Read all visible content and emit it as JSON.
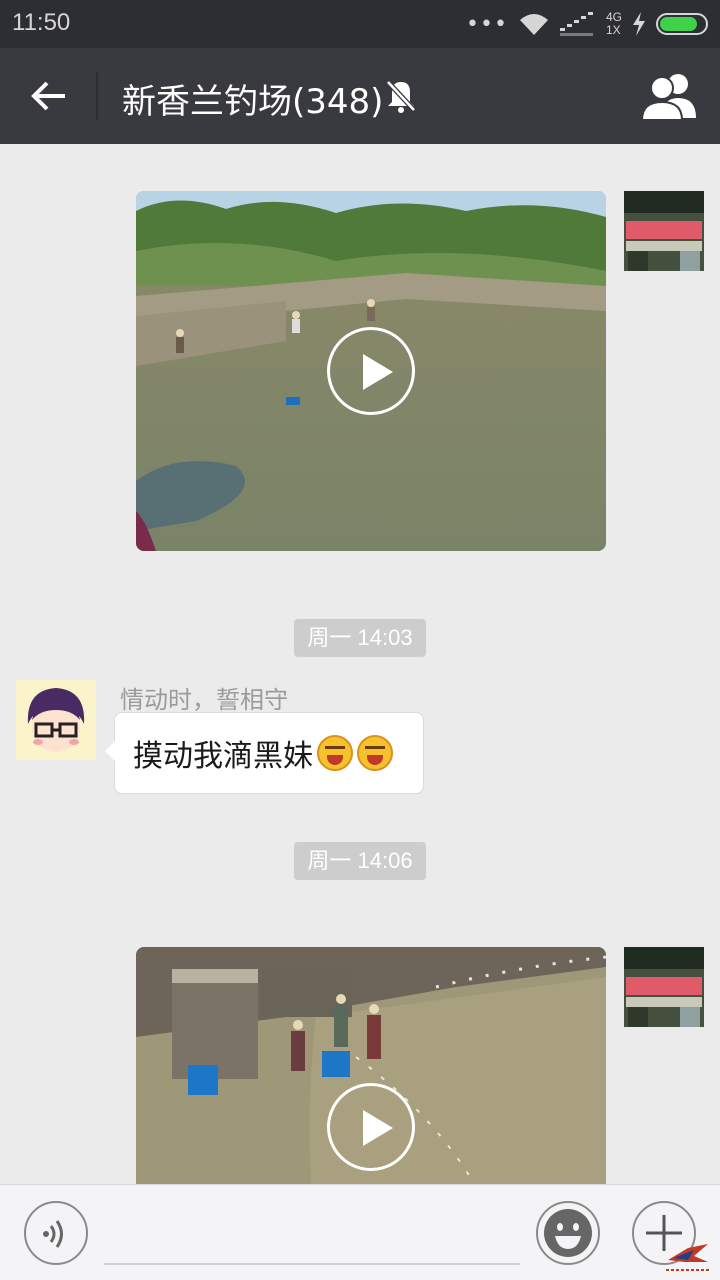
{
  "status_bar": {
    "time": "11:50",
    "network_top": "4G",
    "network_bottom": "1X",
    "battery_level": 0.85,
    "battery_color": "#3fd14a"
  },
  "header": {
    "title": "新香兰钓场(348)",
    "back_icon": "back-arrow-icon",
    "mute_icon": "bell-muted-icon",
    "members_icon": "group-members-icon"
  },
  "messages": [
    {
      "type": "video",
      "side": "right"
    },
    {
      "type": "timestamp",
      "text": "周一 14:03"
    },
    {
      "type": "text",
      "side": "left",
      "sender": "情动时，誓相守",
      "text": "摸动我滴黑妹",
      "emoji_count": 2
    },
    {
      "type": "timestamp",
      "text": "周一 14:06"
    },
    {
      "type": "video",
      "side": "right"
    }
  ],
  "input_bar": {
    "voice_icon": "voice-icon",
    "emoji_icon": "emoji-icon",
    "plus_icon": "plus-icon"
  },
  "colors": {
    "titlebar": "#393a3f",
    "statusbar": "#2d2e33",
    "chat_bg": "#ebebeb"
  }
}
